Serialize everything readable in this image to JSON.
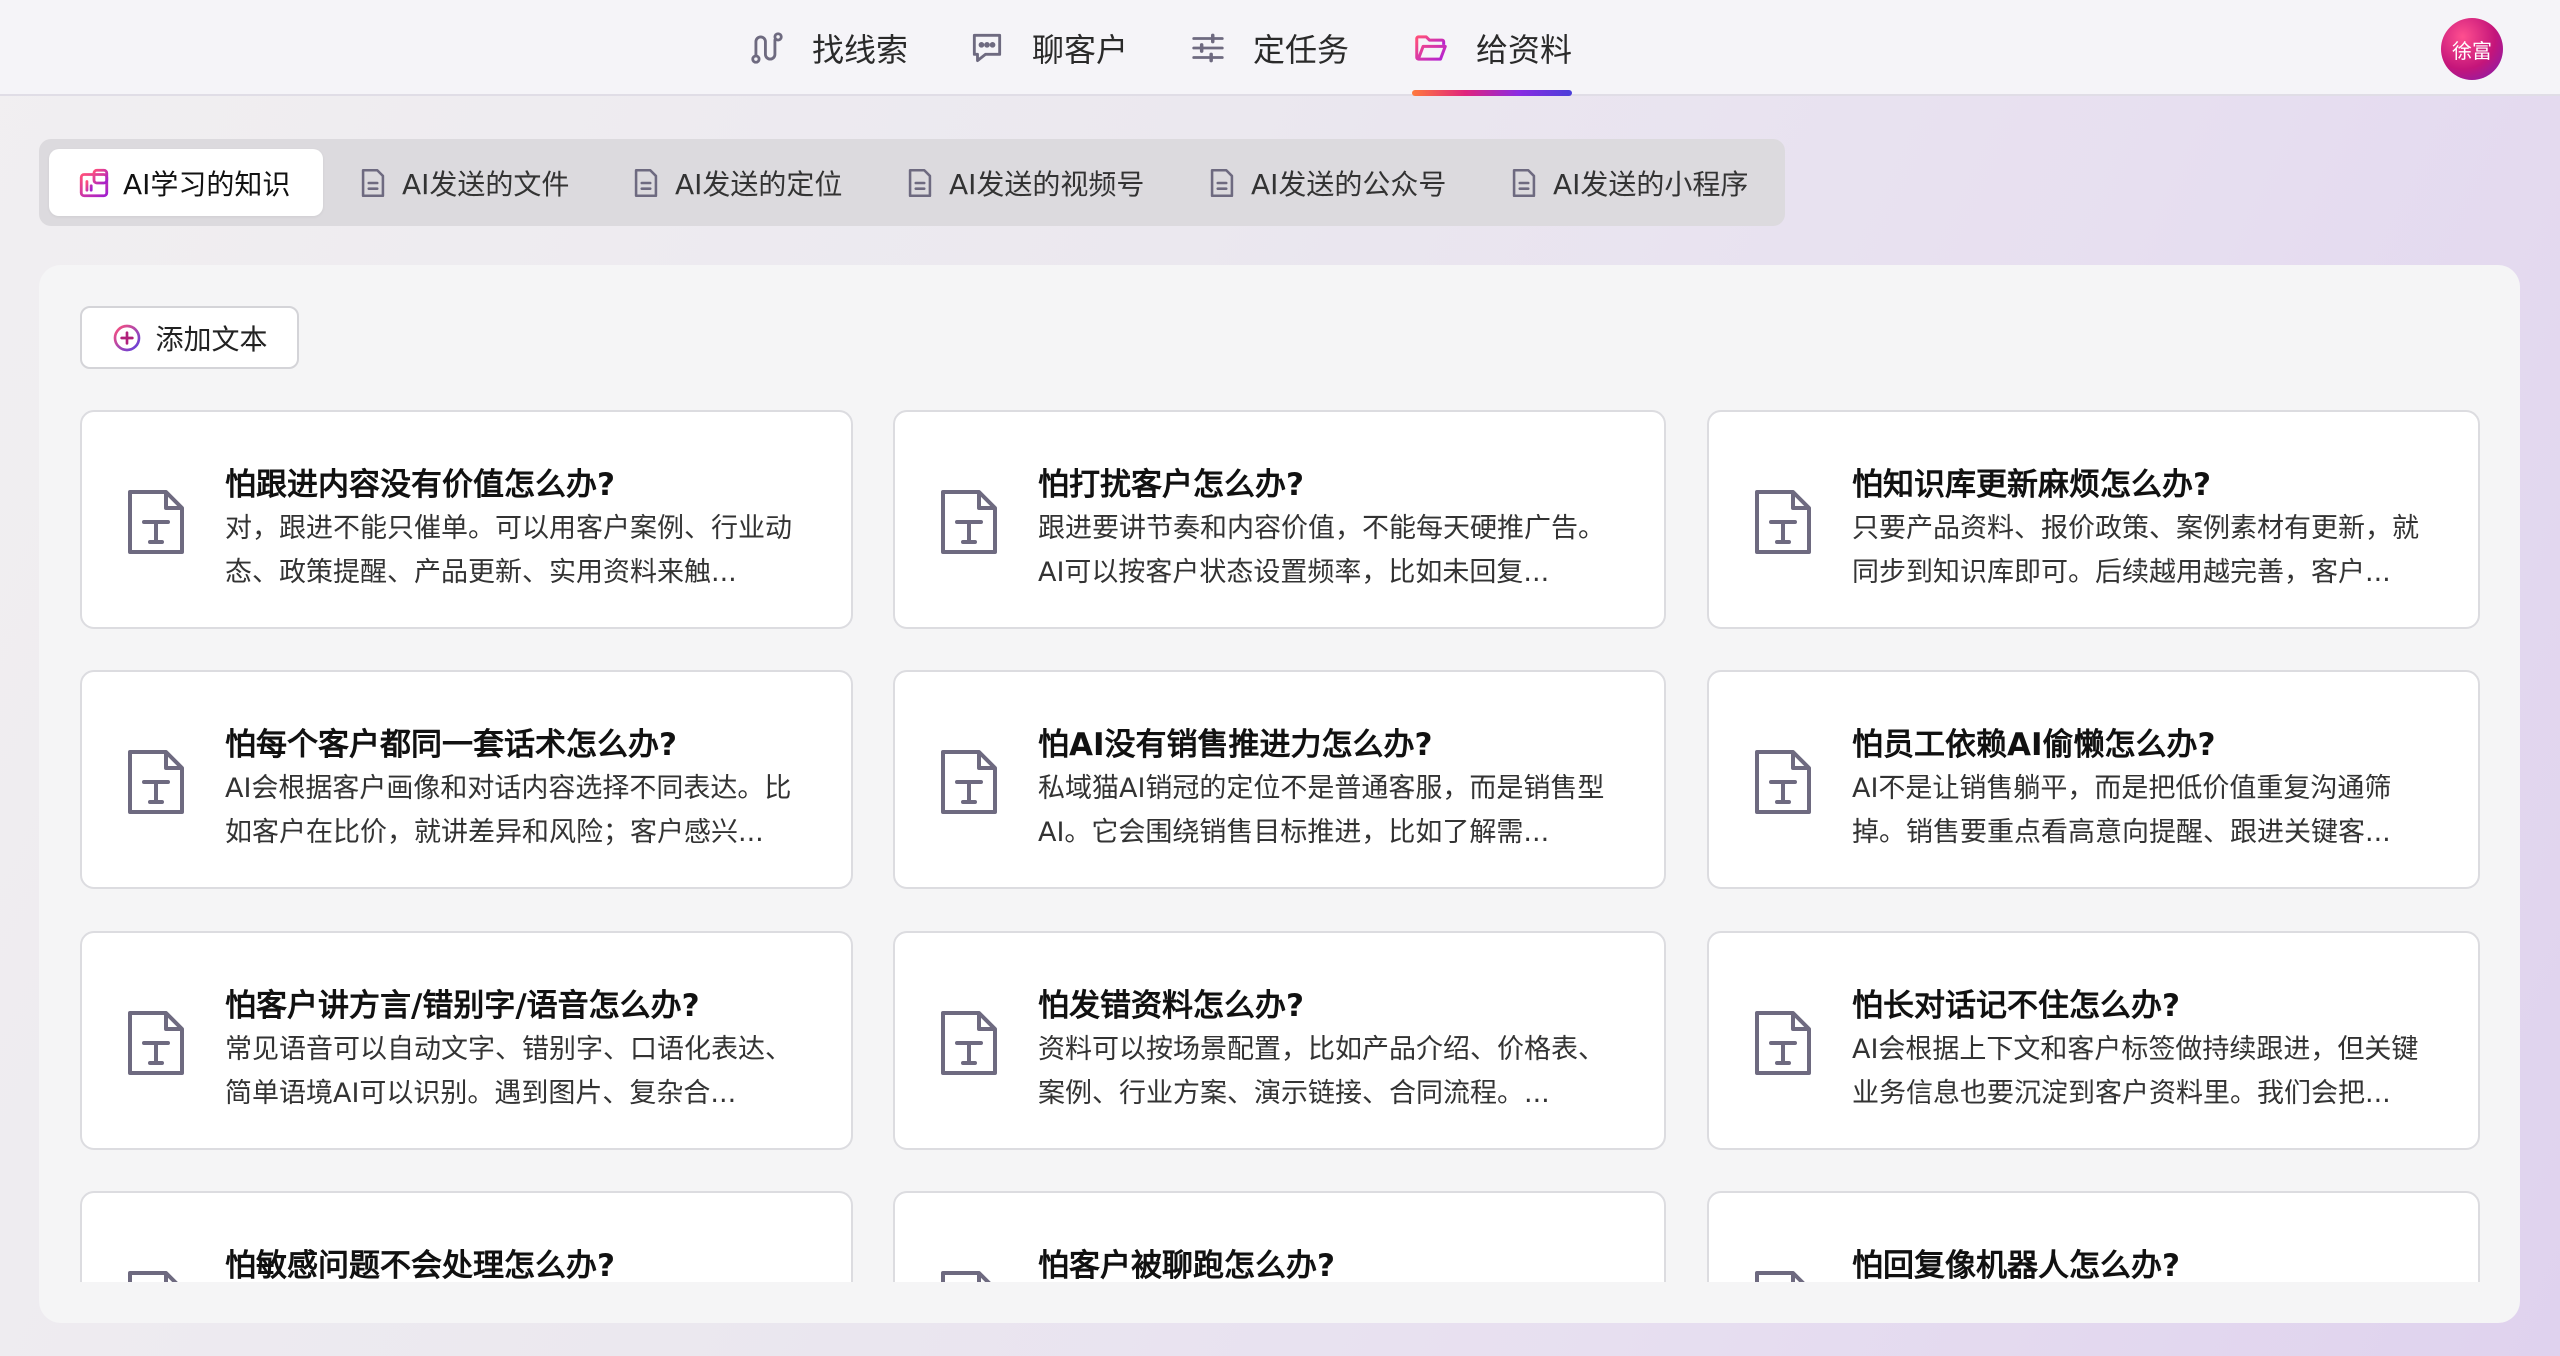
{
  "nav": {
    "items": [
      {
        "label": "找线索",
        "icon": "route-icon"
      },
      {
        "label": "聊客户",
        "icon": "chat-icon"
      },
      {
        "label": "定任务",
        "icon": "sliders-icon"
      },
      {
        "label": "给资料",
        "icon": "folder-icon"
      }
    ],
    "active": "给资料",
    "avatar_text": "徐富"
  },
  "tabs": {
    "items": [
      {
        "label": "AI学习的知识",
        "icon": "knowledge-icon"
      },
      {
        "label": "AI发送的文件",
        "icon": "document-icon"
      },
      {
        "label": "AI发送的定位",
        "icon": "document-icon"
      },
      {
        "label": "AI发送的视频号",
        "icon": "document-icon"
      },
      {
        "label": "AI发送的公众号",
        "icon": "document-icon"
      },
      {
        "label": "AI发送的小程序",
        "icon": "document-icon"
      }
    ],
    "active": "AI学习的知识"
  },
  "toolbar": {
    "add_text_label": "添加文本",
    "add_icon": "plus-circle-icon"
  },
  "cards": [
    {
      "title": "怕跟进内容没有价值怎么办?",
      "desc": "对，跟进不能只催单。可以用客户案例、行业动态、政策提醒、产品更新、实用资料来触..."
    },
    {
      "title": "怕打扰客户怎么办?",
      "desc": "跟进要讲节奏和内容价值，不能每天硬推广告。AI可以按客户状态设置频率，比如未回复..."
    },
    {
      "title": "怕知识库更新麻烦怎么办?",
      "desc": "只要产品资料、报价政策、案例素材有更新，就同步到知识库即可。后续越用越完善，客户..."
    },
    {
      "title": "怕每个客户都同一套话术怎么办?",
      "desc": "AI会根据客户画像和对话内容选择不同表达。比如客户在比价，就讲差异和风险；客户感兴..."
    },
    {
      "title": "怕AI没有销售推进力怎么办?",
      "desc": "私域猫AI销冠的定位不是普通客服，而是销售型AI。它会围绕销售目标推进，比如了解需..."
    },
    {
      "title": "怕员工依赖AI偷懒怎么办?",
      "desc": "AI不是让销售躺平，而是把低价值重复沟通筛掉。销售要重点看高意向提醒、跟进关键客..."
    },
    {
      "title": "怕客户讲方言/错别字/语音怎么办?",
      "desc": "常见语音可以自动文字、错别字、口语化表达、简单语境AI可以识别。遇到图片、复杂合..."
    },
    {
      "title": "怕发错资料怎么办?",
      "desc": "资料可以按场景配置，比如产品介绍、价格表、案例、行业方案、演示链接、合同流程。..."
    },
    {
      "title": "怕长对话记不住怎么办?",
      "desc": "AI会根据上下文和客户标签做持续跟进，但关键业务信息也要沉淀到客户资料里。我们会把..."
    },
    {
      "title": "怕敏感问题不会处理怎么办?",
      "desc": ""
    },
    {
      "title": "怕客户被聊跑怎么办?",
      "desc": ""
    },
    {
      "title": "怕回复像机器人怎么办?",
      "desc": ""
    }
  ],
  "colors": {
    "accent_gradient": [
      "#ff7a3d",
      "#e0237d",
      "#8a2be2",
      "#4b3fd9"
    ],
    "icon_gray": "#6e6a80"
  }
}
